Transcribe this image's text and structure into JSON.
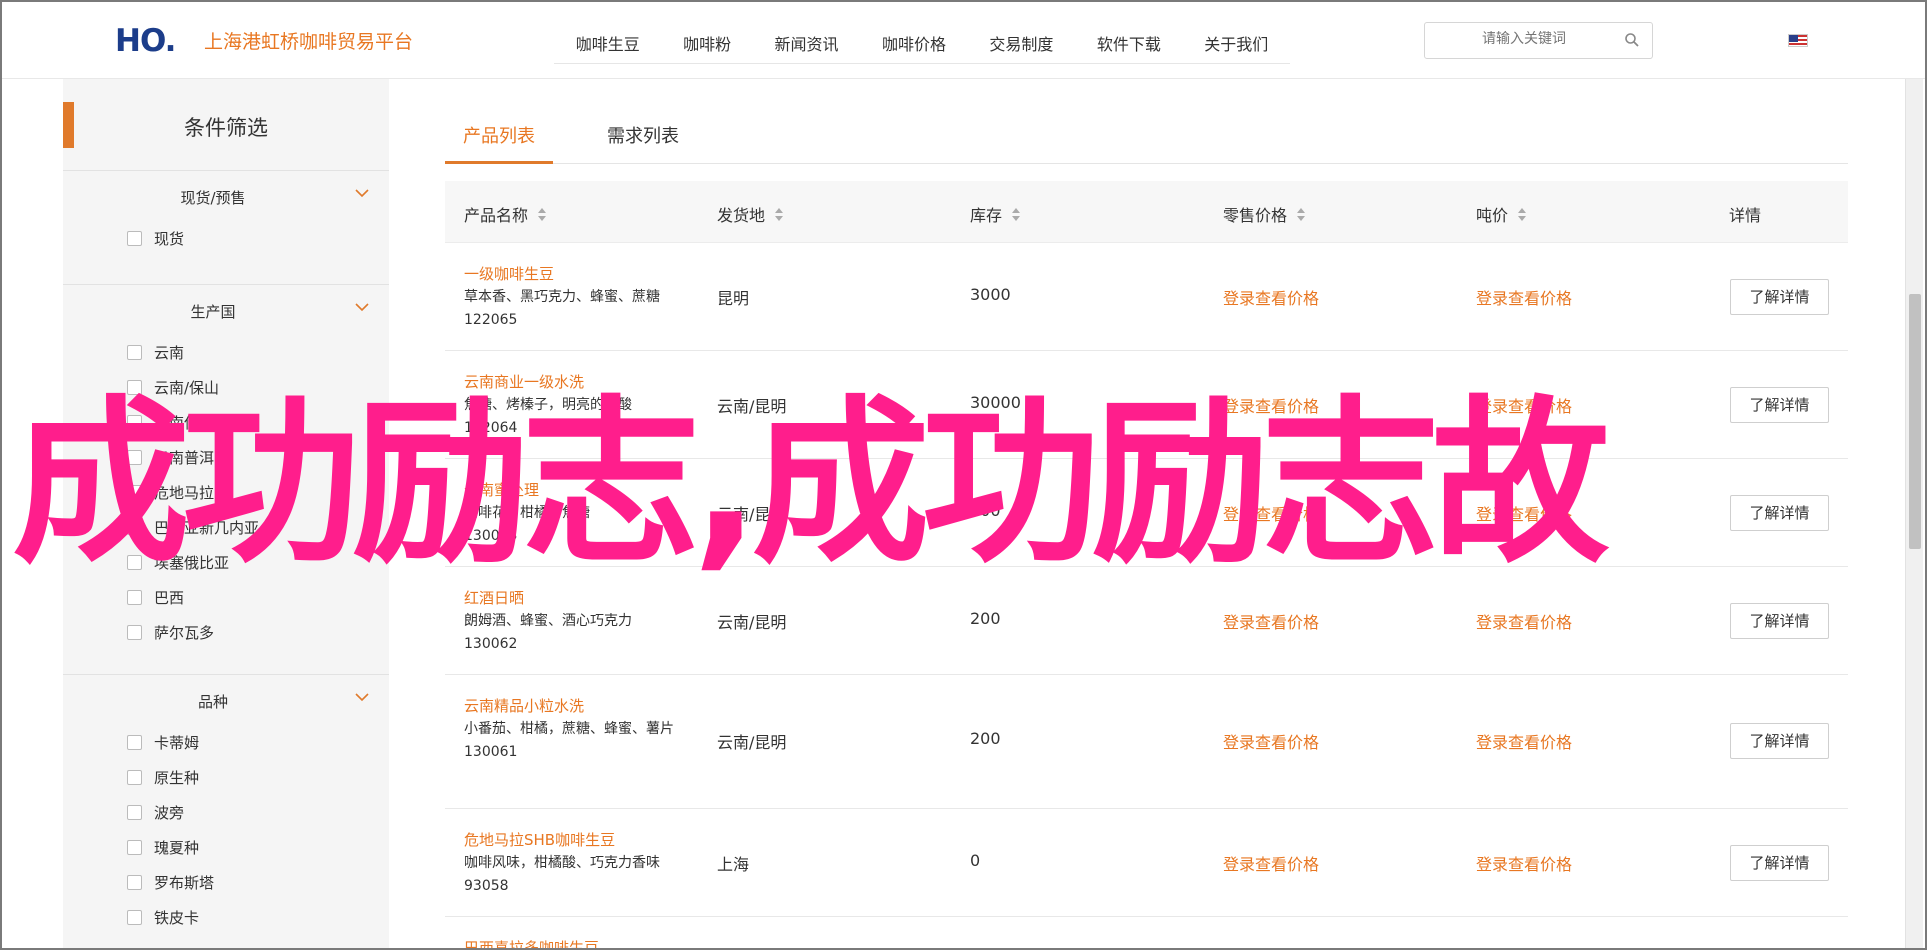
{
  "header": {
    "logo_text": "HO.",
    "site_title": "上海港虹桥咖啡贸易平台",
    "nav": [
      "咖啡生豆",
      "咖啡粉",
      "新闻资讯",
      "咖啡价格",
      "交易制度",
      "软件下载",
      "关于我们"
    ],
    "search_placeholder": "请输入关键词",
    "language_icon": "us-flag-icon"
  },
  "sidebar": {
    "title": "条件筛选",
    "groups": [
      {
        "title": "现货/预售",
        "options": [
          "现货"
        ]
      },
      {
        "title": "生产国",
        "options": [
          "云南",
          "云南/保山",
          "云南保山",
          "云南普洱",
          "危地马拉",
          "巴布亚新几内亚",
          "埃塞俄比亚",
          "巴西",
          "萨尔瓦多"
        ]
      },
      {
        "title": "品种",
        "options": [
          "卡蒂姆",
          "原生种",
          "波旁",
          "瑰夏种",
          "罗布斯塔",
          "铁皮卡"
        ]
      }
    ]
  },
  "main": {
    "tabs": [
      "产品列表",
      "需求列表"
    ],
    "columns": [
      "产品名称",
      "发货地",
      "库存",
      "零售价格",
      "吨价",
      "详情"
    ],
    "rows": [
      {
        "name": "一级咖啡生豆",
        "desc": "草本香、黑巧克力、蜂蜜、蔗糖",
        "code": "122065",
        "origin": "昆明",
        "stock": "3000",
        "retail": "登录查看价格",
        "ton": "登录查看价格",
        "detail": "了解详情"
      },
      {
        "name": "云南商业一级水洗",
        "desc": "焦糖、烤榛子，明亮的果酸",
        "code": "122064",
        "origin": "云南/昆明",
        "stock": "30000",
        "retail": "登录查看价格",
        "ton": "登录查看价格",
        "detail": "了解详情"
      },
      {
        "name": "云南蜜处理",
        "desc": "咖啡花、柑橘、焦糖",
        "code": "130063",
        "origin": "云南/昆明",
        "stock": "200",
        "retail": "登录查看价格",
        "ton": "登录查看价格",
        "detail": "了解详情"
      },
      {
        "name": "红酒日晒",
        "desc": "朗姆酒、蜂蜜、酒心巧克力",
        "code": "130062",
        "origin": "云南/昆明",
        "stock": "200",
        "retail": "登录查看价格",
        "ton": "登录查看价格",
        "detail": "了解详情"
      },
      {
        "name": "云南精品小粒水洗",
        "desc": "小番茄、柑橘，蔗糖、蜂蜜、薯片",
        "code": "130061",
        "origin": "云南/昆明",
        "stock": "200",
        "retail": "登录查看价格",
        "ton": "登录查看价格",
        "detail": "了解详情"
      },
      {
        "name": "危地马拉SHB咖啡生豆",
        "desc": "咖啡风味，柑橘酸、巧克力香味",
        "code": "93058",
        "origin": "上海",
        "stock": "0",
        "retail": "登录查看价格",
        "ton": "登录查看价格",
        "detail": "了解详情"
      },
      {
        "name": "巴西喜拉多咖啡生豆",
        "desc": "",
        "code": "",
        "origin": "",
        "stock": "",
        "retail": "",
        "ton": "",
        "detail": ""
      }
    ]
  },
  "overlay_text": "成功励志,成功励志故"
}
